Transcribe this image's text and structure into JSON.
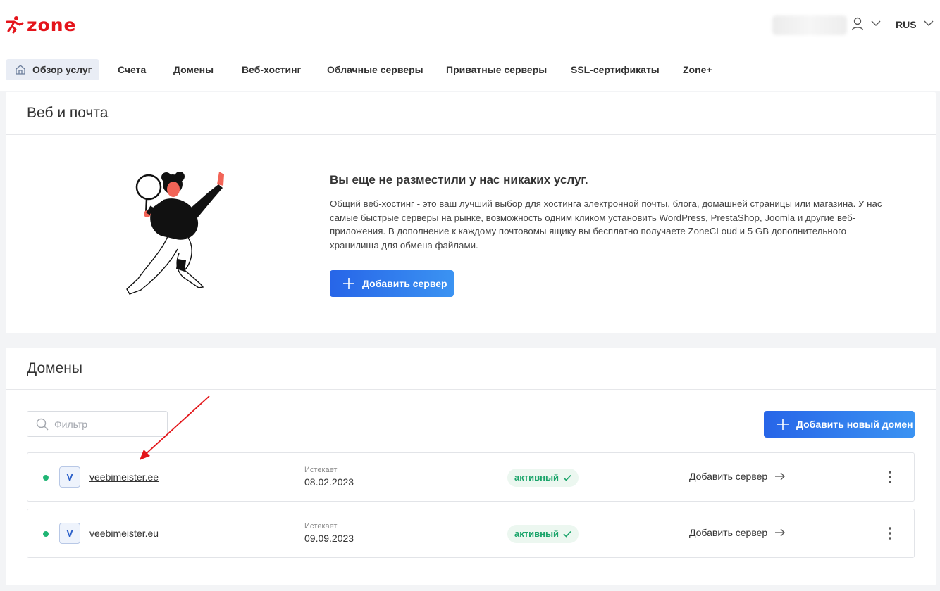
{
  "header": {
    "logo_text": "zone",
    "lang": "RUS",
    "icons": {
      "user": "user-icon",
      "user_chevron": "chevron-down-icon",
      "lang_chevron": "chevron-down-icon"
    }
  },
  "nav": {
    "items": [
      {
        "label": "Обзор услуг",
        "active": true
      },
      {
        "label": "Счета"
      },
      {
        "label": "Домены"
      },
      {
        "label": "Веб-хостинг"
      },
      {
        "label": "Облачные серверы"
      },
      {
        "label": "Приватные серверы"
      },
      {
        "label": "SSL-сертификаты"
      },
      {
        "label": "Zone+"
      }
    ]
  },
  "web_mail": {
    "title": "Веб и почта",
    "empty_title": "Вы еще не разместили у нас никаких услуг.",
    "empty_text": "Общий веб-хостинг - это ваш лучший выбор для хостинга электронной почты, блога, домашней страницы или магазина. У нас самые быстрые серверы на рынке, возможность одним кликом установить WordPress, PrestaShop, Joomla и другие веб-приложения. В дополнение к каждому почтовомы ящику вы бесплатно получаете ZoneCLoud и 5 GB дополнительного хранилища для обмена файлами.",
    "add_server_label": "Добавить сервер"
  },
  "domains": {
    "title": "Домены",
    "filter_placeholder": "Фильтр",
    "add_domain_label": "Добавить новый домен",
    "rows": [
      {
        "avatar": "V",
        "name": "veebimeister.ee",
        "expires_label": "Истекает",
        "expires": "08.02.2023",
        "status": "активный",
        "action": "Добавить сервер"
      },
      {
        "avatar": "V",
        "name": "veebimeister.eu",
        "expires_label": "Истекает",
        "expires": "09.09.2023",
        "status": "активный",
        "action": "Добавить сервер"
      }
    ]
  },
  "colors": {
    "brand_red": "#e4141b",
    "primary_blue": "#2765e8",
    "status_green": "#1fb574",
    "annotation_red": "#e3161a"
  }
}
